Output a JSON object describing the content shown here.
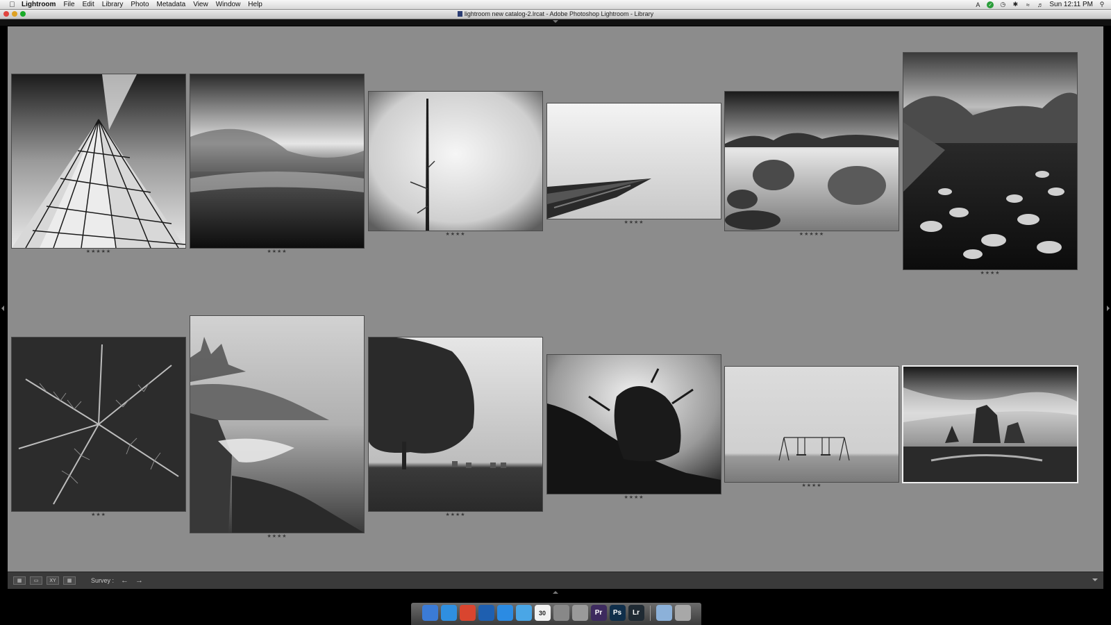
{
  "menubar": {
    "app_name": "Lightroom",
    "items": [
      "File",
      "Edit",
      "Library",
      "Photo",
      "Metadata",
      "View",
      "Window",
      "Help"
    ],
    "clock": "Sun 12:11 PM"
  },
  "window": {
    "title": "lightroom new catalog-2.lrcat - Adobe Photoshop Lightroom - Library"
  },
  "photos": [
    {
      "name": "photo-glass-tower",
      "rating": "★★★★★",
      "selected": false
    },
    {
      "name": "photo-misty-hills",
      "rating": "★★★★",
      "selected": false
    },
    {
      "name": "photo-dead-tree-blur",
      "rating": "★★★★",
      "selected": false
    },
    {
      "name": "photo-pier-fog",
      "rating": "★★★★",
      "selected": false
    },
    {
      "name": "photo-lake-rocks",
      "rating": "★★★★★",
      "selected": false
    },
    {
      "name": "photo-lily-pond",
      "rating": "★★★★",
      "selected": false
    },
    {
      "name": "photo-ferns",
      "rating": "★★★",
      "selected": false
    },
    {
      "name": "photo-foggy-coast",
      "rating": "★★★★",
      "selected": false
    },
    {
      "name": "photo-tree-mist",
      "rating": "★★★★",
      "selected": false
    },
    {
      "name": "photo-tree-silhouette",
      "rating": "★★★★",
      "selected": false
    },
    {
      "name": "photo-swing-set",
      "rating": "★★★★",
      "selected": false
    },
    {
      "name": "photo-sea-stacks",
      "rating": "",
      "selected": true
    }
  ],
  "toolbar": {
    "survey_label": "Survey :",
    "prev_icon": "←",
    "next_icon": "→"
  },
  "dock": {
    "icons": [
      {
        "name": "finder-icon",
        "label": "",
        "color": "#3b7bd6"
      },
      {
        "name": "safari-icon",
        "label": "",
        "color": "#2f8fe0"
      },
      {
        "name": "chrome-icon",
        "label": "",
        "color": "#d9452f"
      },
      {
        "name": "google-earth-icon",
        "label": "",
        "color": "#1e5fb0"
      },
      {
        "name": "app-store-icon",
        "label": "",
        "color": "#2b8be3"
      },
      {
        "name": "itunes-icon",
        "label": "",
        "color": "#4aa6e6"
      },
      {
        "name": "calendar-icon",
        "label": "30",
        "color": "#f2f2f2"
      },
      {
        "name": "scanner-icon",
        "label": "",
        "color": "#888888"
      },
      {
        "name": "preferences-icon",
        "label": "",
        "color": "#9a9a9a"
      },
      {
        "name": "premiere-icon",
        "label": "Pr",
        "color": "#3d2a5e"
      },
      {
        "name": "photoshop-icon",
        "label": "Ps",
        "color": "#0f2e4a"
      },
      {
        "name": "lightroom-icon",
        "label": "Lr",
        "color": "#1f2a33"
      }
    ],
    "trailing_icons": [
      {
        "name": "applications-folder-icon",
        "label": "",
        "color": "#8cb1d9"
      },
      {
        "name": "trash-icon",
        "label": "",
        "color": "#a8a8a8"
      }
    ]
  }
}
